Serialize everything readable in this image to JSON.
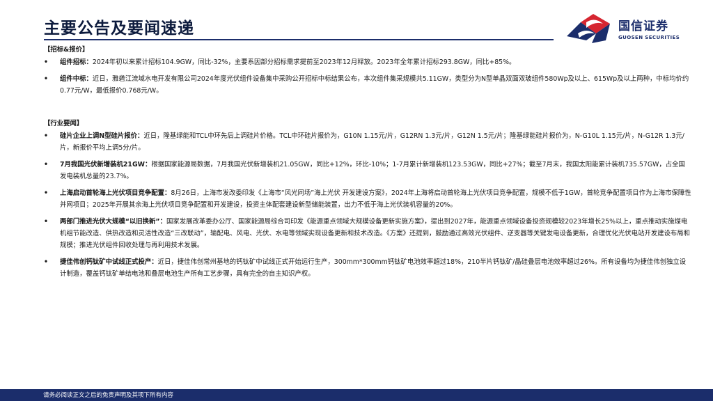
{
  "header": {
    "title": "主要公告及要闻速递",
    "logo_cn": "国信证券",
    "logo_en": "GUOSEN SECURITIES"
  },
  "sections": [
    {
      "heading": "【招标&报价】",
      "items": [
        {
          "bullet": "•",
          "lead": "组件招标：",
          "text": "2024年初以来累计招标104.9GW，同比-32%，主要系因部分招标需求提前至2023年12月释放。2023年全年累计招标293.8GW，同比+85%。"
        },
        {
          "bullet": "•",
          "lead": "组件中标：",
          "text": "近日，雅砻江流域水电开发有限公司2024年度光伏组件设备集中采购公开招标中标结果公布，本次组件集采规模共5.11GW，类型分为N型单晶双面双玻组件580Wp及以上、615Wp及以上两种，中标均价约0.77元/W，最低报价0.768元/W。"
        }
      ]
    },
    {
      "heading": "【行业要闻】",
      "items": [
        {
          "bullet": "•",
          "lead": "硅片企业上调N型硅片报价：",
          "text": "近日，隆基绿能和TCL中环先后上调硅片价格。TCL中环硅片报价为，G10N 1.15元/片，G12RN 1.3元/片，G12N 1.5元/片；隆基绿能硅片报价为，N-G10L 1.15元/片，N-G12R 1.3元/片，新报价平均上调5分/片。"
        },
        {
          "bullet": "•",
          "lead": "7月我国光伏新增装机21GW：",
          "text": "根据国家能源局数据，7月我国光伏新增装机21.05GW，同比+12%，环比-10%；1-7月累计新增装机123.53GW，同比+27%；截至7月末，我国太阳能累计装机735.57GW，占全国发电装机总量的23.7%。"
        },
        {
          "bullet": "•",
          "lead": "上海启动首轮海上光伏项目竞争配置：",
          "text": "8月26日，上海市发改委印发《上海市“风光同场”海上光伏 开发建设方案》，2024年上海将启动首轮海上光伏项目竞争配置，规模不低于1GW，首轮竞争配置项目作为上海市保障性并网项目；2025年开展其余海上光伏项目竞争配置和开发建设，投资主体配套建设新型储能装置，出力不低于海上光伏装机容量的20%。"
        },
        {
          "bullet": "•",
          "lead": "两部门推进光伏大规模“以旧换新”：",
          "text": "国家发展改革委办公厅、国家能源局综合司印发《能源重点领域大规模设备更新实施方案》，提出到2027年，能源重点领域设备投资规模较2023年增长25%以上，重点推动实施煤电机组节能改造、供热改造和灵活性改造“三改联动”，输配电、风电、光伏、水电等领域实现设备更新和技术改造。《方案》还提到，鼓励通过高效光伏组件、逆变器等关键发电设备更新，合理优化光伏电站开发建设布局和规模；推进光伏组件回收处理与再利用技术发展。"
        },
        {
          "bullet": "•",
          "lead": "捷佳伟创钙钛矿中试线正式投产：",
          "text": "近日，捷佳伟创常州基地的钙钛矿中试线正式开始运行生产，300mm*300mm钙钛矿电池效率超过18%，210半片钙钛矿/晶硅叠层电池效率超过26%。所有设备均为捷佳伟创独立设计制造，覆盖钙钛矿单结电池和叠层电池生产所有工艺步骤，具有完全的自主知识产权。"
        }
      ]
    }
  ],
  "footer": {
    "disclaimer": "请务必阅读正文之后的免责声明及其项下所有内容"
  },
  "colors": {
    "brand_navy": "#1b2d6b",
    "brand_red": "#d62631"
  }
}
